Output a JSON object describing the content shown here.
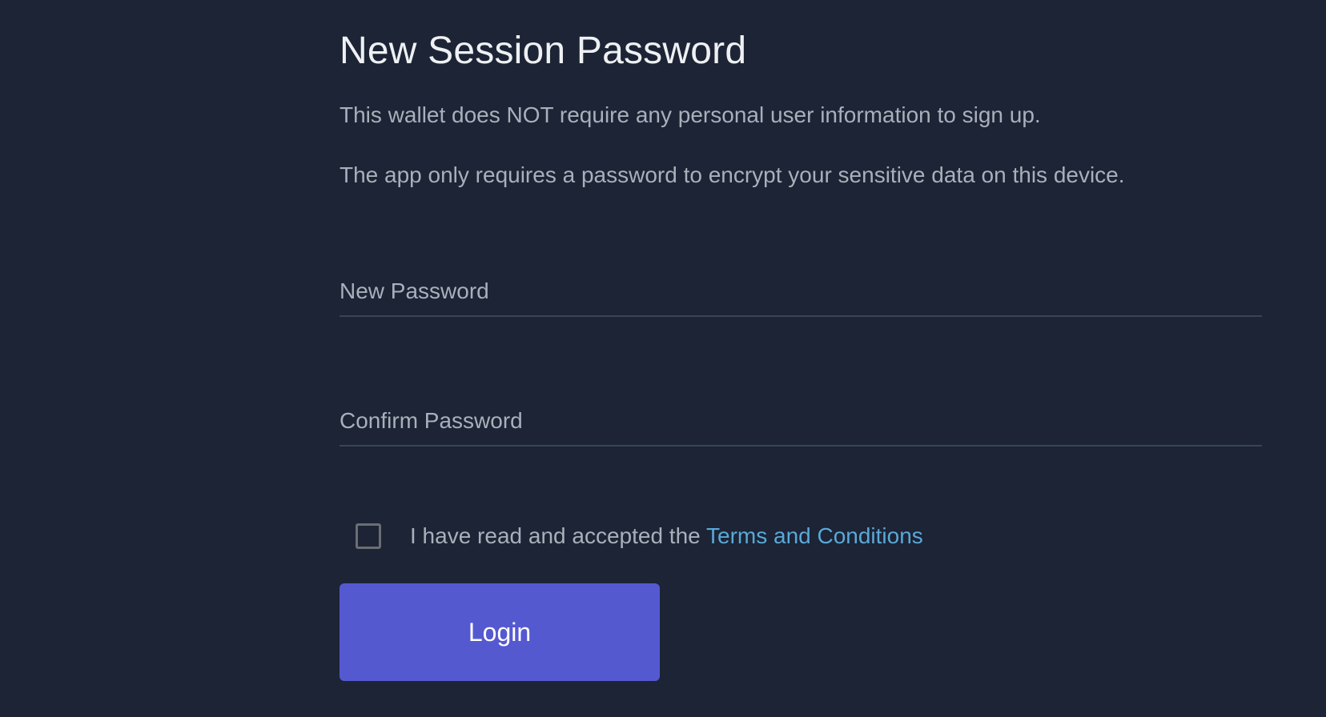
{
  "header": {
    "title": "New Session Password"
  },
  "description": {
    "line1": "This wallet does NOT require any personal user information to sign up.",
    "line2": "The app only requires a password to encrypt your sensitive data on this device."
  },
  "fields": {
    "new_password": {
      "placeholder": "New Password",
      "value": ""
    },
    "confirm_password": {
      "placeholder": "Confirm Password",
      "value": ""
    }
  },
  "terms": {
    "checked": false,
    "text": "I have read and accepted the ",
    "link_label": "Terms and Conditions"
  },
  "actions": {
    "login_label": "Login"
  },
  "colors": {
    "background": "#1c2435",
    "title": "#eef0f3",
    "body_text": "#a9b0bb",
    "link": "#5aa8d8",
    "primary_button": "#5559d0",
    "divider": "#3a4456"
  }
}
